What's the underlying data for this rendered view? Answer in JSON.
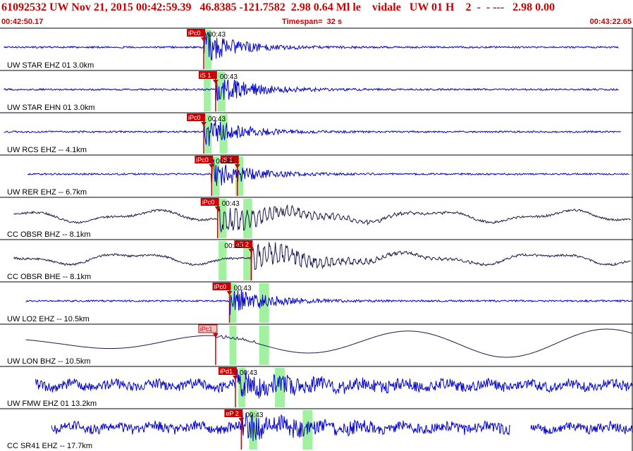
{
  "header": {
    "title": "61092532 UW Nov 21, 2015 00:42:59.39   46.8385 -121.7582  2.98 0.64 Ml le    vidale   UW 01 H    2  -  - ---   2.98 0.00",
    "start_time": "00:42:50.17",
    "timespan": "Timespan=  32 s",
    "end_time": "00:43:22.65"
  },
  "colors": {
    "header_text": "#cc0000",
    "trace_blue": "#0000cc",
    "trace_dark": "#1a1a4e",
    "pick_fill": "#cc0000",
    "pick_light_fill": "#f4c0c0",
    "window_green": "#90ee90",
    "separator": "#000000"
  },
  "chart_data": {
    "type": "seismogram",
    "time_start": "00:42:50.17",
    "time_end": "00:43:22.65",
    "timespan_s": 32,
    "minute_mark_label": "00:43",
    "channels": [
      {
        "label": "UW STAR EHZ 01 3.0km",
        "trace_style": "blue",
        "data_from_s": 0.2,
        "data_to_s": 31.3,
        "envelope": "noise-burst",
        "picks": [
          {
            "label": "iPc0",
            "t_s": 10.3,
            "style": "solid"
          }
        ],
        "windows_s": [
          [
            10.35,
            10.7
          ]
        ],
        "show_minute_mark": true
      },
      {
        "label": "UW STAR EHN 01 3.0km",
        "trace_style": "blue",
        "data_from_s": 0.2,
        "data_to_s": 31.3,
        "envelope": "noise-burst",
        "picks": [
          {
            "label": "iS 1",
            "t_s": 10.9,
            "style": "solid"
          }
        ],
        "windows_s": [
          [
            10.3,
            10.65
          ],
          [
            11.0,
            11.4
          ]
        ],
        "show_minute_mark": true
      },
      {
        "label": "UW RCS EHZ -- 4.1km",
        "trace_style": "blue",
        "data_from_s": 0.2,
        "data_to_s": 31.4,
        "envelope": "noise-burst",
        "picks": [
          {
            "label": "iPc0",
            "t_s": 10.3,
            "style": "solid"
          }
        ],
        "windows_s": [
          [
            10.35,
            10.7
          ],
          [
            11.1,
            11.5
          ]
        ],
        "show_minute_mark": true
      },
      {
        "label": "UW RER EHZ -- 6.7km",
        "trace_style": "blue",
        "data_from_s": 1.4,
        "data_to_s": 31.8,
        "envelope": "noise-burst",
        "picks": [
          {
            "label": "iPc0",
            "t_s": 10.7,
            "style": "solid"
          },
          {
            "label": "iS 1",
            "t_s": 12.0,
            "style": "solid"
          }
        ],
        "windows_s": [
          [
            10.75,
            11.1
          ],
          [
            11.9,
            12.3
          ]
        ],
        "show_minute_mark": true
      },
      {
        "label": "CC OBSR BHZ -- 8.1km",
        "trace_style": "dark",
        "data_from_s": 0.7,
        "data_to_s": 31.9,
        "envelope": "wave-burst",
        "picks": [
          {
            "label": "iPc0",
            "t_s": 11.0,
            "style": "solid"
          }
        ],
        "windows_s": [
          [
            11.05,
            11.45
          ],
          [
            12.3,
            12.75
          ]
        ],
        "show_minute_mark": true
      },
      {
        "label": "CC OBSR BHE -- 8.1km",
        "trace_style": "dark",
        "data_from_s": 0.7,
        "data_to_s": 31.9,
        "envelope": "wave-burst",
        "picks": [
          {
            "label": "eS 2",
            "t_s": 12.7,
            "style": "solid"
          }
        ],
        "windows_s": [
          [
            11.05,
            11.45
          ],
          [
            12.3,
            12.75
          ]
        ],
        "show_minute_mark": true
      },
      {
        "label": "UW LO2 EHZ -- 10.5km",
        "trace_style": "blue",
        "data_from_s": 1.3,
        "data_to_s": 32.3,
        "envelope": "noise-burst",
        "picks": [
          {
            "label": "iPc0",
            "t_s": 11.6,
            "style": "solid"
          }
        ],
        "windows_s": [
          [
            11.6,
            11.95
          ],
          [
            13.1,
            13.6
          ]
        ],
        "show_minute_mark": true
      },
      {
        "label": "UW LON BHZ -- 10.5km",
        "trace_style": "dark",
        "data_from_s": 1.3,
        "data_to_s": 32.0,
        "envelope": "long-period",
        "picks": [
          {
            "label": "iPc1",
            "t_s": 10.9,
            "style": "light"
          }
        ],
        "windows_s": [
          [
            11.6,
            11.95
          ],
          [
            13.1,
            13.6
          ]
        ],
        "show_minute_mark": false
      },
      {
        "label": "UW FMW EHZ 01 13.2km",
        "trace_style": "blue",
        "data_from_s": 1.8,
        "data_to_s": 32.8,
        "envelope": "noisy",
        "picks": [
          {
            "label": "iPd1",
            "t_s": 11.9,
            "style": "solid"
          }
        ],
        "windows_s": [
          [
            12.05,
            12.4
          ],
          [
            13.9,
            14.4
          ]
        ],
        "show_minute_mark": true
      },
      {
        "label": "CC SR41 EHZ -- 17.7km",
        "trace_style": "blue",
        "data_from_s": 2.6,
        "data_to_s": 33.5,
        "gap_s": [
          25.8,
          26.8
        ],
        "envelope": "noisy",
        "picks": [
          {
            "label": "eP 2",
            "t_s": 12.2,
            "style": "solid"
          }
        ],
        "windows_s": [
          [
            12.6,
            13.0
          ],
          [
            15.3,
            15.8
          ]
        ],
        "show_minute_mark": true
      }
    ]
  }
}
